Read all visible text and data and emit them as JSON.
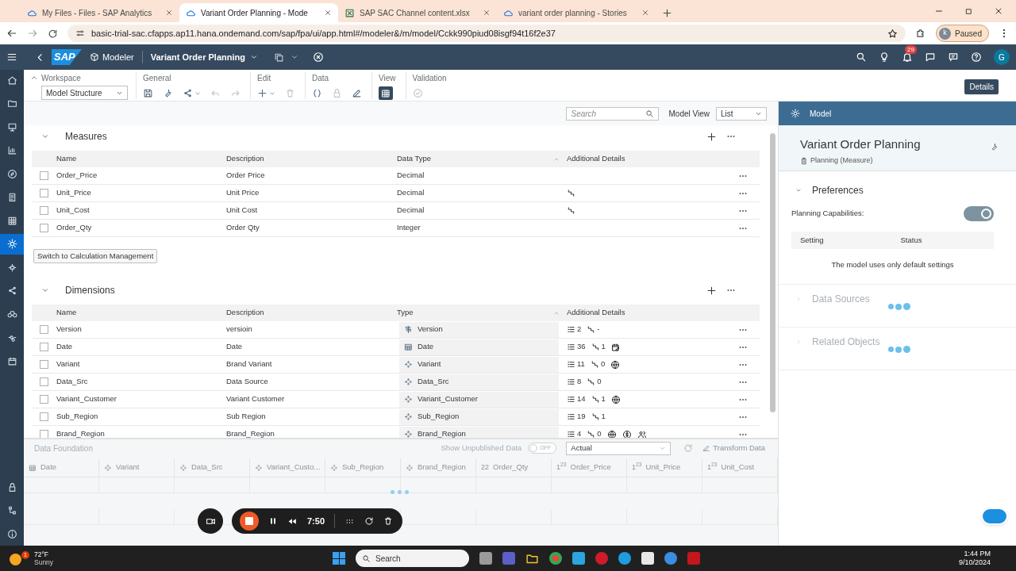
{
  "browser": {
    "tabs": [
      {
        "title": "My Files - Files - SAP Analytics",
        "kind": "cloud",
        "selected": false
      },
      {
        "title": "Variant Order Planning - Mode",
        "kind": "cloud",
        "selected": true
      },
      {
        "title": "SAP SAC Channel content.xlsx",
        "kind": "sheet",
        "selected": false
      },
      {
        "title": "variant order planning - Stories",
        "kind": "cloud",
        "selected": false
      }
    ],
    "url": "basic-trial-sac.cfapps.ap11.hana.ondemand.com/sap/fpa/ui/app.html#/modeler&/m/model/Cckk990piud08isgf94t16f2e37",
    "profile_initial": "k",
    "profile_status": "Paused"
  },
  "shell": {
    "logo": "SAP",
    "app": "Modeler",
    "model_title": "Variant Order Planning",
    "notification_count": "29",
    "avatar": "G"
  },
  "sidebar": {
    "items": [
      {
        "kind": "home",
        "selected": false
      },
      {
        "kind": "folder",
        "selected": false
      },
      {
        "kind": "easel",
        "selected": false
      },
      {
        "kind": "chart",
        "selected": false
      },
      {
        "kind": "compass",
        "selected": false
      },
      {
        "kind": "checklist",
        "selected": false
      },
      {
        "kind": "table",
        "selected": false
      },
      {
        "kind": "gear",
        "selected": true
      },
      {
        "kind": "flow",
        "selected": false
      },
      {
        "kind": "share",
        "selected": false
      },
      {
        "kind": "binoculars",
        "selected": false
      },
      {
        "kind": "links",
        "selected": false
      },
      {
        "kind": "calendar",
        "selected": false
      }
    ],
    "bottom_items": [
      {
        "kind": "lock",
        "selected": false
      },
      {
        "kind": "tree",
        "selected": false
      },
      {
        "kind": "info",
        "selected": false
      }
    ]
  },
  "toolbar": {
    "workspace": {
      "label": "Workspace",
      "value": "Model Structure"
    },
    "groups": [
      {
        "label": "General",
        "items": [
          {
            "kind": "save",
            "disabled": false,
            "caret": false
          },
          {
            "kind": "wrench",
            "disabled": false,
            "caret": false
          },
          {
            "kind": "share",
            "disabled": false,
            "caret": true
          },
          {
            "kind": "undo",
            "disabled": true,
            "caret": false
          },
          {
            "kind": "redo",
            "disabled": true,
            "caret": false
          }
        ]
      },
      {
        "label": "Edit",
        "items": [
          {
            "kind": "plus",
            "disabled": false,
            "caret": true
          },
          {
            "kind": "trash",
            "disabled": true,
            "caret": false
          }
        ]
      },
      {
        "label": "Data",
        "items": [
          {
            "kind": "braces",
            "disabled": false,
            "caret": false
          },
          {
            "kind": "lock",
            "disabled": true,
            "caret": false
          },
          {
            "kind": "pencil",
            "disabled": false,
            "caret": false
          }
        ]
      },
      {
        "label": "View",
        "items": [
          {
            "kind": "table",
            "disabled": false,
            "caret": false,
            "selected": true
          }
        ]
      },
      {
        "label": "Validation",
        "items": [
          {
            "kind": "check",
            "disabled": true,
            "caret": false
          }
        ]
      }
    ],
    "details_button": "Details"
  },
  "view_bar": {
    "search_placeholder": "Search",
    "model_view_label": "Model View",
    "model_view_value": "List"
  },
  "measures": {
    "title": "Measures",
    "columns": [
      "Name",
      "Description",
      "Data Type",
      "Additional Details"
    ],
    "rows": [
      {
        "name": "Order_Price",
        "description": "Order Price",
        "data_type": "Decimal",
        "hierarchy": false,
        "checked": false
      },
      {
        "name": "Unit_Price",
        "description": "Unit Price",
        "data_type": "Decimal",
        "hierarchy": true,
        "checked": false
      },
      {
        "name": "Unit_Cost",
        "description": "Unit Cost",
        "data_type": "Decimal",
        "hierarchy": true,
        "checked": false
      },
      {
        "name": "Order_Qty",
        "description": "Order Qty",
        "data_type": "Integer",
        "hierarchy": false,
        "checked": false
      }
    ],
    "switch_button": "Switch to Calculation Management"
  },
  "dimensions": {
    "title": "Dimensions",
    "columns": [
      "Name",
      "Description",
      "Type",
      "Additional Details"
    ],
    "rows": [
      {
        "name": "Version",
        "description": "versioin",
        "type": "Version",
        "kind": "version",
        "members": "2",
        "hierarchies": "-",
        "extras": [],
        "checked": false
      },
      {
        "name": "Date",
        "description": "Date",
        "type": "Date",
        "kind": "date",
        "members": "36",
        "hierarchies": "1",
        "extras": [
          {
            "kind": "time"
          }
        ],
        "checked": false
      },
      {
        "name": "Variant",
        "description": "Brand Variant",
        "type": "Variant",
        "kind": "generic",
        "members": "11",
        "hierarchies": "0",
        "extras": [
          {
            "kind": "globe"
          }
        ],
        "checked": false
      },
      {
        "name": "Data_Src",
        "description": "Data Source",
        "type": "Data_Src",
        "kind": "generic",
        "members": "8",
        "hierarchies": "0",
        "extras": [],
        "checked": false
      },
      {
        "name": "Variant_Customer",
        "description": "Variant Customer",
        "type": "Variant_Customer",
        "kind": "generic",
        "members": "14",
        "hierarchies": "1",
        "extras": [
          {
            "kind": "globe"
          }
        ],
        "checked": false
      },
      {
        "name": "Sub_Region",
        "description": "Sub Region",
        "type": "Sub_Region",
        "kind": "generic",
        "members": "19",
        "hierarchies": "1",
        "extras": [],
        "checked": false
      },
      {
        "name": "Brand_Region",
        "description": "Brand_Region",
        "type": "Brand_Region",
        "kind": "generic",
        "members": "4",
        "hierarchies": "0",
        "extras": [
          {
            "kind": "globe"
          },
          {
            "kind": "currency"
          },
          {
            "kind": "people"
          }
        ],
        "checked": false
      }
    ]
  },
  "data_foundation": {
    "title": "Data Foundation",
    "unpublished_toggle": {
      "label": "Show Unpublished Data",
      "on": false,
      "state_text": "OFF"
    },
    "version_value": "Actual",
    "transform_button": "Transform Data",
    "columns": [
      {
        "kind": "date",
        "label": "Date"
      },
      {
        "kind": "generic",
        "label": "Variant"
      },
      {
        "kind": "generic",
        "label": "Data_Src"
      },
      {
        "kind": "generic",
        "label": "Variant_Custo..."
      },
      {
        "kind": "generic",
        "label": "Sub_Region"
      },
      {
        "kind": "generic",
        "label": "Brand_Region"
      },
      {
        "kind": "measure",
        "mark": "22",
        "label": "Order_Qty"
      },
      {
        "kind": "measure",
        "mark": "1$^{23}$",
        "label": "Order_Price"
      },
      {
        "kind": "measure",
        "mark": "1$^{23}$",
        "label": "Unit_Price"
      },
      {
        "kind": "measure",
        "mark": "1$^{23}$",
        "label": "Unit_Cost"
      }
    ]
  },
  "recorder": {
    "time": "7:50"
  },
  "model_panel": {
    "header": "Model",
    "title": "Variant Order Planning",
    "subtitle": "Planning (Measure)",
    "sections": [
      {
        "title": "Preferences",
        "kind": "preferences",
        "expanded": true,
        "capability_label": "Planning Capabilities:",
        "capability_on": true,
        "columns": [
          "Setting",
          "Status"
        ],
        "message": "The model uses only default settings"
      },
      {
        "title": "Data Sources",
        "kind": "loading",
        "expanded": false
      },
      {
        "title": "Related Objects",
        "kind": "loading",
        "expanded": false
      }
    ]
  },
  "taskbar": {
    "weather_badge": "1",
    "temperature": "72°F",
    "condition": "Sunny",
    "search_placeholder": "Search",
    "time": "1:44 PM",
    "date": "9/10/2024"
  }
}
